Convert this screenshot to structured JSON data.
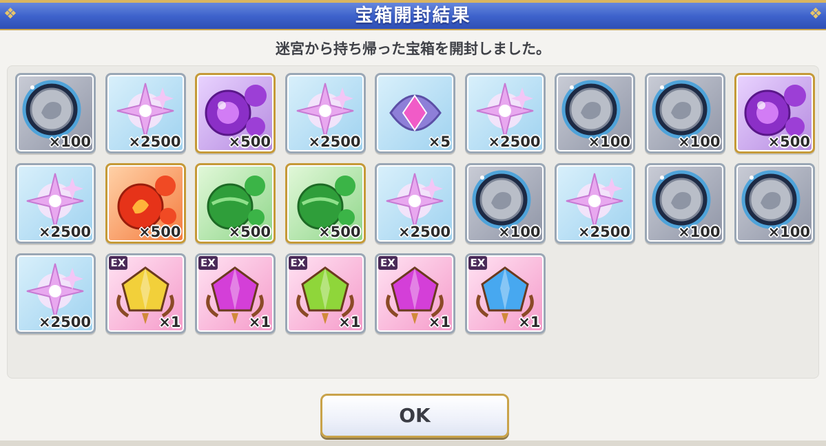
{
  "dialog": {
    "title": "宝箱開封結果",
    "message": "迷宮から持ち帰った宝箱を開封しました。",
    "ok_label": "OK"
  },
  "items": [
    {
      "icon": "silver-coin-icon",
      "qty": "×100",
      "frame": "silver",
      "bg": "gray"
    },
    {
      "icon": "pink-star-shard-icon",
      "qty": "×2500",
      "frame": "silver",
      "bg": "blue"
    },
    {
      "icon": "purple-orb-icon",
      "qty": "×500",
      "frame": "gold",
      "bg": "purplebg"
    },
    {
      "icon": "pink-star-shard-icon",
      "qty": "×2500",
      "frame": "silver",
      "bg": "blue"
    },
    {
      "icon": "pink-crystal-emblem-icon",
      "qty": "×5",
      "frame": "silver",
      "bg": "blue"
    },
    {
      "icon": "pink-star-shard-icon",
      "qty": "×2500",
      "frame": "silver",
      "bg": "blue"
    },
    {
      "icon": "silver-coin-icon",
      "qty": "×100",
      "frame": "silver",
      "bg": "gray"
    },
    {
      "icon": "silver-coin-icon",
      "qty": "×100",
      "frame": "silver",
      "bg": "gray"
    },
    {
      "icon": "purple-orb-icon",
      "qty": "×500",
      "frame": "gold",
      "bg": "purplebg"
    },
    {
      "icon": "pink-star-shard-icon",
      "qty": "×2500",
      "frame": "silver",
      "bg": "blue"
    },
    {
      "icon": "red-fire-orb-icon",
      "qty": "×500",
      "frame": "gold",
      "bg": "red"
    },
    {
      "icon": "green-orb-icon",
      "qty": "×500",
      "frame": "gold",
      "bg": "green"
    },
    {
      "icon": "green-orb-icon",
      "qty": "×500",
      "frame": "gold",
      "bg": "green"
    },
    {
      "icon": "pink-star-shard-icon",
      "qty": "×2500",
      "frame": "silver",
      "bg": "blue"
    },
    {
      "icon": "silver-coin-icon",
      "qty": "×100",
      "frame": "silver",
      "bg": "gray"
    },
    {
      "icon": "pink-star-shard-icon",
      "qty": "×2500",
      "frame": "silver",
      "bg": "blue"
    },
    {
      "icon": "silver-coin-icon",
      "qty": "×100",
      "frame": "silver",
      "bg": "gray"
    },
    {
      "icon": "silver-coin-icon",
      "qty": "×100",
      "frame": "silver",
      "bg": "gray"
    },
    {
      "icon": "pink-star-shard-icon",
      "qty": "×2500",
      "frame": "silver",
      "bg": "blue"
    },
    {
      "icon": "yellow-ex-gem-icon",
      "qty": "×1",
      "ex": "EX",
      "frame": "silver",
      "bg": "pink",
      "gem": "#f2d03a"
    },
    {
      "icon": "magenta-ex-gem-icon",
      "qty": "×1",
      "ex": "EX",
      "frame": "silver",
      "bg": "pink",
      "gem": "#d43fd8"
    },
    {
      "icon": "green-ex-gem-icon",
      "qty": "×1",
      "ex": "EX",
      "frame": "silver",
      "bg": "pink",
      "gem": "#8fd63a"
    },
    {
      "icon": "magenta-ex-gem-icon",
      "qty": "×1",
      "ex": "EX",
      "frame": "silver",
      "bg": "pink",
      "gem": "#d43fd8"
    },
    {
      "icon": "blue-ex-gem-icon",
      "qty": "×1",
      "ex": "EX",
      "frame": "silver",
      "bg": "pink",
      "gem": "#47a8f0"
    }
  ]
}
